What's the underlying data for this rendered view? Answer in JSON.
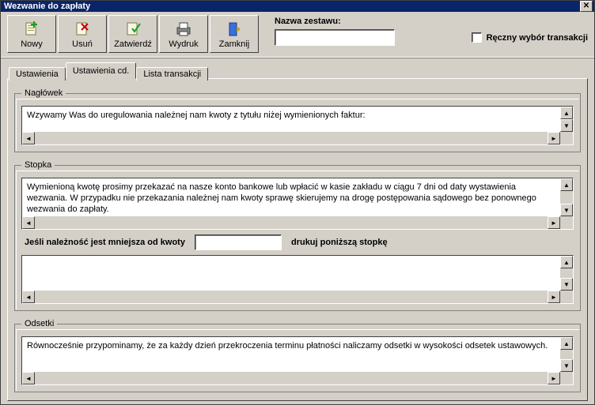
{
  "window": {
    "title": "Wezwanie do zapłaty"
  },
  "toolbar": {
    "new_label": "Nowy",
    "delete_label": "Usuń",
    "confirm_label": "Zatwierdź",
    "print_label": "Wydruk",
    "close_label": "Zamknij",
    "set_name_label": "Nazwa zestawu:",
    "set_name_value": "",
    "manual_tx_label": "Ręczny wybór transakcji"
  },
  "tabs": {
    "settings": "Ustawienia",
    "settings_cont": "Ustawienia cd.",
    "tx_list": "Lista transakcji"
  },
  "groups": {
    "header": {
      "legend": "Nagłówek",
      "text": "Wzywamy Was do uregulowania należnej nam kwoty z tytułu niżej wymienionych faktur:"
    },
    "footer": {
      "legend": "Stopka",
      "text": "Wymienioną kwotę prosimy przekazać na nasze konto bankowe lub wpłacić w kasie zakładu w ciągu 7 dni od daty wystawienia wezwania. W przypadku nie przekazania należnej nam kwoty sprawę skierujemy na drogę postępowania sądowego bez ponownego wezwania do zapłaty.",
      "threshold_label": "Jeśli należność jest mniejsza od kwoty",
      "threshold_value": "",
      "print_below_label": "drukuj poniższą stopkę",
      "alt_text": ""
    },
    "interest": {
      "legend": "Odsetki",
      "text": "Równocześnie przypominamy, że za każdy dzień przekroczenia terminu płatności naliczamy odsetki w wysokości odsetek ustawowych."
    }
  }
}
